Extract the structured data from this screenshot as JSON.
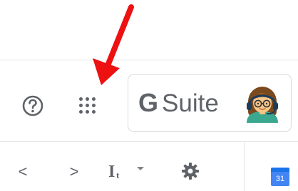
{
  "toolbar": {
    "help_icon": "help-circle-icon",
    "apps_icon": "apps-grid-icon"
  },
  "account": {
    "brand_letter": "G",
    "brand_name": "Suite",
    "avatar_icon": "person-avatar-icon"
  },
  "annotation": {
    "arrow_color": "#ee1111",
    "arrow_icon": "red-arrow-annotation"
  },
  "mail_toolbar": {
    "prev_label": "<",
    "next_label": ">",
    "input_tools_label": "Iₜ",
    "settings_icon": "gear-icon",
    "calendar_day": "31"
  }
}
